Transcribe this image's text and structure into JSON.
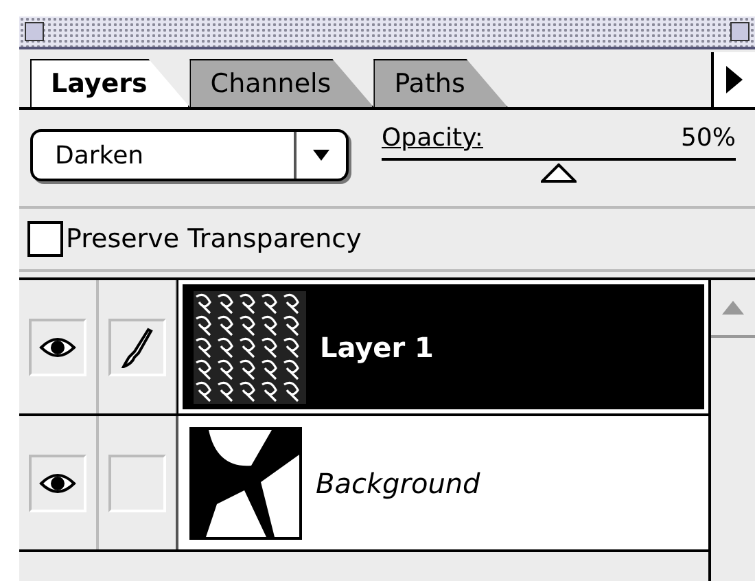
{
  "palette": {
    "tabs": [
      {
        "label": "Layers",
        "selected": true
      },
      {
        "label": "Channels",
        "selected": false
      },
      {
        "label": "Paths",
        "selected": false
      }
    ],
    "blend_mode": "Darken",
    "opacity": {
      "label": "Opacity:",
      "value": "50%",
      "level": 0.5
    },
    "preserve_transparency": {
      "label": "Preserve Transparency",
      "checked": false
    },
    "layers": [
      {
        "name": "Layer 1",
        "kind": "layer",
        "visible": true,
        "editing": true,
        "selected": true
      },
      {
        "name": "Background",
        "kind": "background",
        "visible": true,
        "editing": false,
        "selected": false
      }
    ]
  }
}
